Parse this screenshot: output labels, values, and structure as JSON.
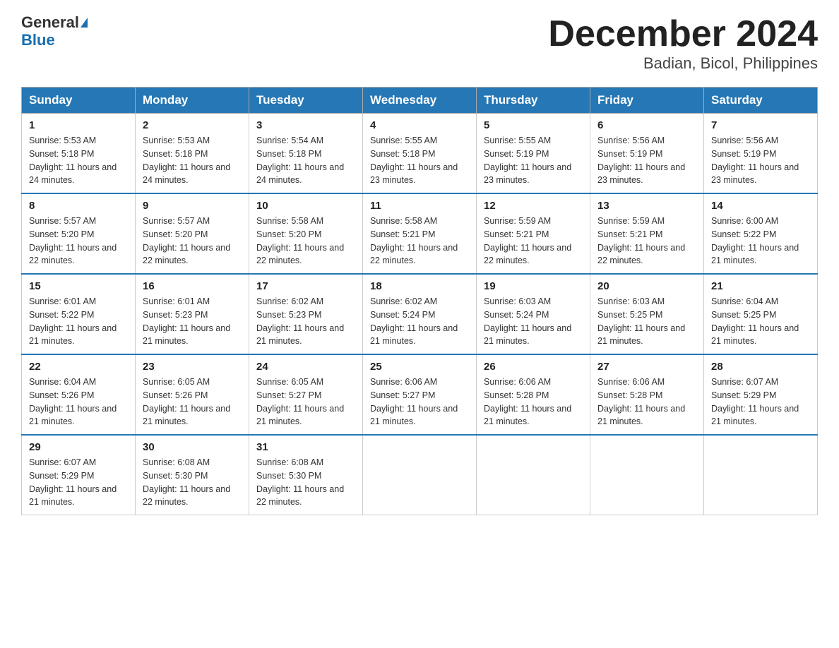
{
  "header": {
    "logo_general": "General",
    "logo_blue": "Blue",
    "month_title": "December 2024",
    "subtitle": "Badian, Bicol, Philippines"
  },
  "days_of_week": [
    "Sunday",
    "Monday",
    "Tuesday",
    "Wednesday",
    "Thursday",
    "Friday",
    "Saturday"
  ],
  "weeks": [
    [
      {
        "day": "1",
        "sunrise": "5:53 AM",
        "sunset": "5:18 PM",
        "daylight": "11 hours and 24 minutes."
      },
      {
        "day": "2",
        "sunrise": "5:53 AM",
        "sunset": "5:18 PM",
        "daylight": "11 hours and 24 minutes."
      },
      {
        "day": "3",
        "sunrise": "5:54 AM",
        "sunset": "5:18 PM",
        "daylight": "11 hours and 24 minutes."
      },
      {
        "day": "4",
        "sunrise": "5:55 AM",
        "sunset": "5:18 PM",
        "daylight": "11 hours and 23 minutes."
      },
      {
        "day": "5",
        "sunrise": "5:55 AM",
        "sunset": "5:19 PM",
        "daylight": "11 hours and 23 minutes."
      },
      {
        "day": "6",
        "sunrise": "5:56 AM",
        "sunset": "5:19 PM",
        "daylight": "11 hours and 23 minutes."
      },
      {
        "day": "7",
        "sunrise": "5:56 AM",
        "sunset": "5:19 PM",
        "daylight": "11 hours and 23 minutes."
      }
    ],
    [
      {
        "day": "8",
        "sunrise": "5:57 AM",
        "sunset": "5:20 PM",
        "daylight": "11 hours and 22 minutes."
      },
      {
        "day": "9",
        "sunrise": "5:57 AM",
        "sunset": "5:20 PM",
        "daylight": "11 hours and 22 minutes."
      },
      {
        "day": "10",
        "sunrise": "5:58 AM",
        "sunset": "5:20 PM",
        "daylight": "11 hours and 22 minutes."
      },
      {
        "day": "11",
        "sunrise": "5:58 AM",
        "sunset": "5:21 PM",
        "daylight": "11 hours and 22 minutes."
      },
      {
        "day": "12",
        "sunrise": "5:59 AM",
        "sunset": "5:21 PM",
        "daylight": "11 hours and 22 minutes."
      },
      {
        "day": "13",
        "sunrise": "5:59 AM",
        "sunset": "5:21 PM",
        "daylight": "11 hours and 22 minutes."
      },
      {
        "day": "14",
        "sunrise": "6:00 AM",
        "sunset": "5:22 PM",
        "daylight": "11 hours and 21 minutes."
      }
    ],
    [
      {
        "day": "15",
        "sunrise": "6:01 AM",
        "sunset": "5:22 PM",
        "daylight": "11 hours and 21 minutes."
      },
      {
        "day": "16",
        "sunrise": "6:01 AM",
        "sunset": "5:23 PM",
        "daylight": "11 hours and 21 minutes."
      },
      {
        "day": "17",
        "sunrise": "6:02 AM",
        "sunset": "5:23 PM",
        "daylight": "11 hours and 21 minutes."
      },
      {
        "day": "18",
        "sunrise": "6:02 AM",
        "sunset": "5:24 PM",
        "daylight": "11 hours and 21 minutes."
      },
      {
        "day": "19",
        "sunrise": "6:03 AM",
        "sunset": "5:24 PM",
        "daylight": "11 hours and 21 minutes."
      },
      {
        "day": "20",
        "sunrise": "6:03 AM",
        "sunset": "5:25 PM",
        "daylight": "11 hours and 21 minutes."
      },
      {
        "day": "21",
        "sunrise": "6:04 AM",
        "sunset": "5:25 PM",
        "daylight": "11 hours and 21 minutes."
      }
    ],
    [
      {
        "day": "22",
        "sunrise": "6:04 AM",
        "sunset": "5:26 PM",
        "daylight": "11 hours and 21 minutes."
      },
      {
        "day": "23",
        "sunrise": "6:05 AM",
        "sunset": "5:26 PM",
        "daylight": "11 hours and 21 minutes."
      },
      {
        "day": "24",
        "sunrise": "6:05 AM",
        "sunset": "5:27 PM",
        "daylight": "11 hours and 21 minutes."
      },
      {
        "day": "25",
        "sunrise": "6:06 AM",
        "sunset": "5:27 PM",
        "daylight": "11 hours and 21 minutes."
      },
      {
        "day": "26",
        "sunrise": "6:06 AM",
        "sunset": "5:28 PM",
        "daylight": "11 hours and 21 minutes."
      },
      {
        "day": "27",
        "sunrise": "6:06 AM",
        "sunset": "5:28 PM",
        "daylight": "11 hours and 21 minutes."
      },
      {
        "day": "28",
        "sunrise": "6:07 AM",
        "sunset": "5:29 PM",
        "daylight": "11 hours and 21 minutes."
      }
    ],
    [
      {
        "day": "29",
        "sunrise": "6:07 AM",
        "sunset": "5:29 PM",
        "daylight": "11 hours and 21 minutes."
      },
      {
        "day": "30",
        "sunrise": "6:08 AM",
        "sunset": "5:30 PM",
        "daylight": "11 hours and 22 minutes."
      },
      {
        "day": "31",
        "sunrise": "6:08 AM",
        "sunset": "5:30 PM",
        "daylight": "11 hours and 22 minutes."
      },
      null,
      null,
      null,
      null
    ]
  ],
  "labels": {
    "sunrise": "Sunrise:",
    "sunset": "Sunset:",
    "daylight": "Daylight:"
  }
}
